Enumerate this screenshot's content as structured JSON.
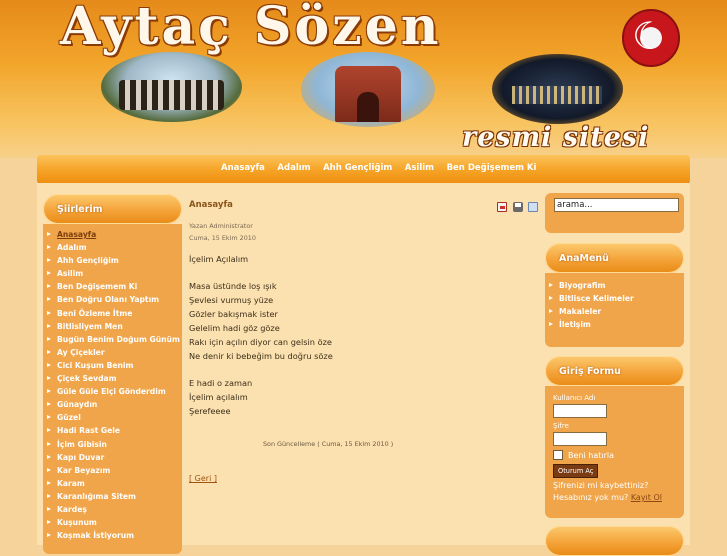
{
  "header": {
    "title": "Aytaç Sözen",
    "subtitle": "resmi sitesi"
  },
  "topnav": {
    "items": [
      "Anasayfa",
      "Adalım",
      "Ahh Gençliğim",
      "Asilim",
      "Ben Değişemem Ki"
    ]
  },
  "left_module": {
    "heading": "Şiirlerim",
    "items": [
      "Anasayfa",
      "Adalım",
      "Ahh Gençliğim",
      "Asilim",
      "Ben Değişemem Ki",
      "Ben Doğru Olanı Yaptım",
      "Beni Özleme İtme",
      "Bitlisliyem Men",
      "Bugün Benim Doğum Günüm",
      "Ay Çiçekler",
      "Cici Kuşum Benim",
      "Çiçek Sevdam",
      "Güle Güle Elçi Gönderdim",
      "Günaydın",
      "Güzel",
      "Hadi Rast Gele",
      "İçim Gibisin",
      "Kapı Duvar",
      "Kar Beyazım",
      "Karam",
      "Karanlığıma Sitem",
      "Kardeş",
      "Kuşunum",
      "Koşmak İstiyorum"
    ],
    "active_index": 0
  },
  "article": {
    "title": "Anasayfa",
    "author": "Yazan Administrator",
    "date": "Cuma, 15 Ekim 2010",
    "poem": [
      [
        "İçelim Açılalım"
      ],
      [
        "Masa üstünde loş ışık",
        "Şevlesi vurmuş yüze",
        "Gözler bakışmak ister",
        "Gelelim hadi göz göze",
        "Rakı için açılın diyor can gelsin öze",
        "Ne denir ki bebeğim bu doğru söze"
      ],
      [
        "E hadi o zaman",
        "İçelim açılalım",
        "Şerefeeee"
      ]
    ],
    "modified": "Son Güncelleme ( Cuma, 15 Ekim 2010 )",
    "back": "[ Geri ]",
    "icons": [
      "pdf-icon",
      "print-icon",
      "email-icon"
    ]
  },
  "search": {
    "value": "arama..."
  },
  "anamenu": {
    "heading": "AnaMenü",
    "items": [
      "Biyografim",
      "Bitlisce Kelimeler",
      "Makaleler",
      "İletişim"
    ]
  },
  "login": {
    "heading": "Giriş Formu",
    "username_label": "Kullanıcı Adı",
    "password_label": "Şifre",
    "remember_label": "Beni hatırla",
    "submit_label": "Oturum Aç",
    "forgot_link": "Şifrenizi mi kaybettiniz?",
    "register_text": "Hesabınız yok mu?",
    "register_link": "Kayıt Ol"
  },
  "colors": {
    "accent": "#f3a035",
    "page_bg": "#fbe0b0",
    "nav_text": "#ffffff"
  }
}
